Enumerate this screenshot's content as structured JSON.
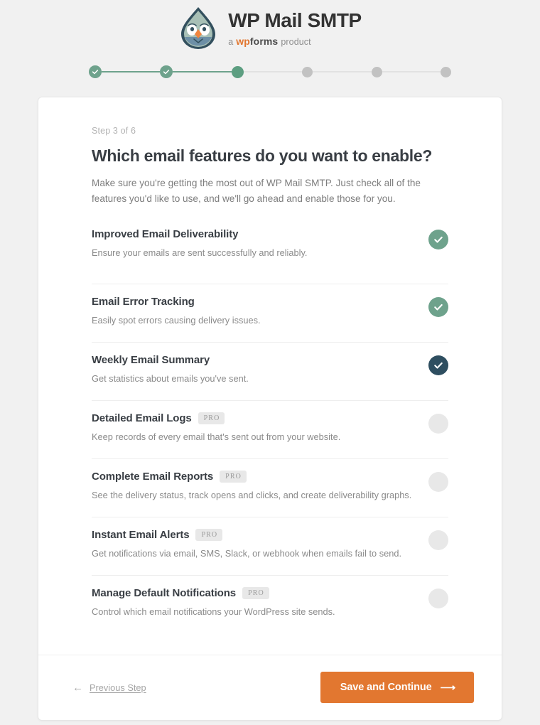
{
  "brand": {
    "title": "WP Mail SMTP",
    "tagline_prefix": "a",
    "tagline_wp": "wp",
    "tagline_forms": "forms",
    "tagline_suffix": "product",
    "logo_icon": "wp-mail-smtp-bird-logo",
    "accent_orange": "#e27730",
    "accent_green": "#6ea28c",
    "accent_navy": "#2e4e60"
  },
  "stepper": {
    "total": 6,
    "current": 3,
    "steps": [
      {
        "state": "done"
      },
      {
        "state": "done"
      },
      {
        "state": "active"
      },
      {
        "state": "todo"
      },
      {
        "state": "todo"
      },
      {
        "state": "todo"
      }
    ]
  },
  "setup": {
    "step_label": "Step 3 of 6",
    "headline": "Which email features do you want to enable?",
    "intro": "Make sure you're getting the most out of WP Mail SMTP. Just check all of the features you'd like to use, and we'll go ahead and enable those for you."
  },
  "features": [
    {
      "title": "Improved Email Deliverability",
      "description": "Ensure your emails are sent successfully and reliably.",
      "pro": false,
      "pro_label": "",
      "toggle_state": "on"
    },
    {
      "title": "Email Error Tracking",
      "description": "Easily spot errors causing delivery issues.",
      "pro": false,
      "pro_label": "",
      "toggle_state": "on"
    },
    {
      "title": "Weekly Email Summary",
      "description": "Get statistics about emails you've sent.",
      "pro": false,
      "pro_label": "",
      "toggle_state": "focused"
    },
    {
      "title": "Detailed Email Logs",
      "description": "Keep records of every email that's sent out from your website.",
      "pro": true,
      "pro_label": "PRO",
      "toggle_state": "off"
    },
    {
      "title": "Complete Email Reports",
      "description": "See the delivery status, track opens and clicks, and create deliverability graphs.",
      "pro": true,
      "pro_label": "PRO",
      "toggle_state": "off"
    },
    {
      "title": "Instant Email Alerts",
      "description": "Get notifications via email, SMS, Slack, or webhook when emails fail to send.",
      "pro": true,
      "pro_label": "PRO",
      "toggle_state": "off"
    },
    {
      "title": "Manage Default Notifications",
      "description": "Control which email notifications your WordPress site sends.",
      "pro": true,
      "pro_label": "PRO",
      "toggle_state": "off"
    }
  ],
  "footer": {
    "previous_label": "Previous Step",
    "previous_icon": "arrow-left-icon",
    "save_label": "Save and Continue",
    "save_icon": "arrow-right-icon"
  }
}
